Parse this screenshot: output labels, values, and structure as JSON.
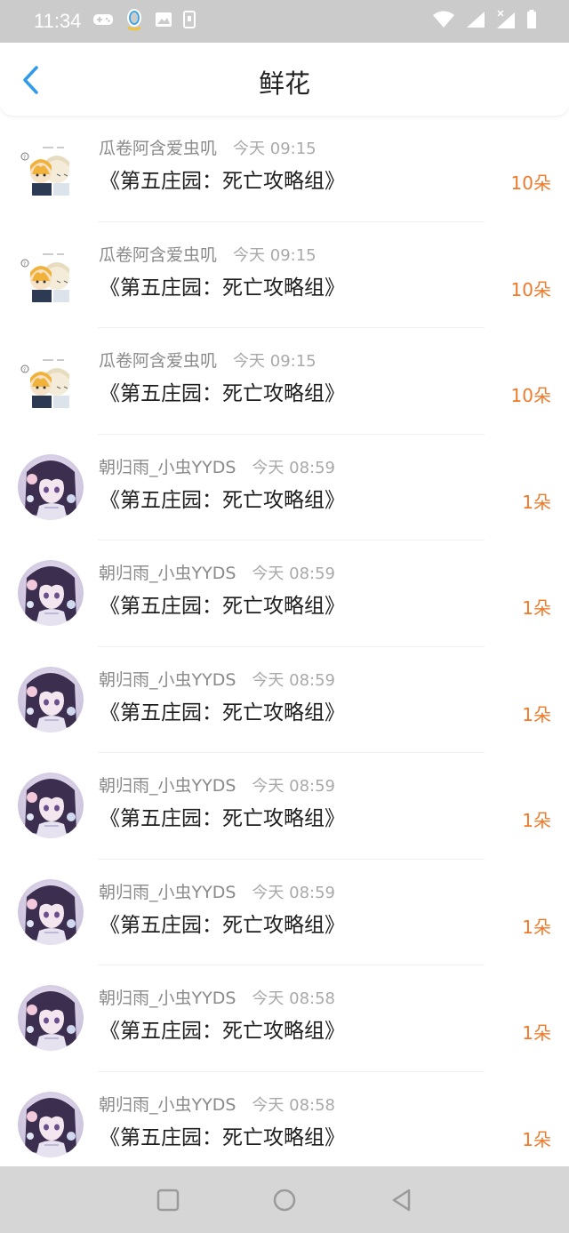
{
  "status_bar": {
    "time": "11:34"
  },
  "header": {
    "title": "鲜花"
  },
  "colors": {
    "accent_blue": "#2f9bea",
    "flower_count_orange": "#f07a2a",
    "status_bar_bg": "#cbcbcb",
    "nav_bar_bg": "#d6d6d6"
  },
  "items": [
    {
      "avatar": "chibi-avatar",
      "name": "瓜卷阿含爱虫叽",
      "time": "今天 09:15",
      "book": "《第五庄园：死亡攻略组》",
      "count": "10朵"
    },
    {
      "avatar": "chibi-avatar",
      "name": "瓜卷阿含爱虫叽",
      "time": "今天 09:15",
      "book": "《第五庄园：死亡攻略组》",
      "count": "10朵"
    },
    {
      "avatar": "chibi-avatar",
      "name": "瓜卷阿含爱虫叽",
      "time": "今天 09:15",
      "book": "《第五庄园：死亡攻略组》",
      "count": "10朵"
    },
    {
      "avatar": "anime-girl-avatar",
      "name": "朝归雨_小虫YYDS",
      "time": "今天 08:59",
      "book": "《第五庄园：死亡攻略组》",
      "count": "1朵"
    },
    {
      "avatar": "anime-girl-avatar",
      "name": "朝归雨_小虫YYDS",
      "time": "今天 08:59",
      "book": "《第五庄园：死亡攻略组》",
      "count": "1朵"
    },
    {
      "avatar": "anime-girl-avatar",
      "name": "朝归雨_小虫YYDS",
      "time": "今天 08:59",
      "book": "《第五庄园：死亡攻略组》",
      "count": "1朵"
    },
    {
      "avatar": "anime-girl-avatar",
      "name": "朝归雨_小虫YYDS",
      "time": "今天 08:59",
      "book": "《第五庄园：死亡攻略组》",
      "count": "1朵"
    },
    {
      "avatar": "anime-girl-avatar",
      "name": "朝归雨_小虫YYDS",
      "time": "今天 08:59",
      "book": "《第五庄园：死亡攻略组》",
      "count": "1朵"
    },
    {
      "avatar": "anime-girl-avatar",
      "name": "朝归雨_小虫YYDS",
      "time": "今天 08:58",
      "book": "《第五庄园：死亡攻略组》",
      "count": "1朵"
    },
    {
      "avatar": "anime-girl-avatar",
      "name": "朝归雨_小虫YYDS",
      "time": "今天 08:58",
      "book": "《第五庄园：死亡攻略组》",
      "count": "1朵"
    }
  ],
  "nav_bar": {
    "icons": [
      "recents-square-icon",
      "home-circle-icon",
      "back-triangle-icon"
    ]
  }
}
